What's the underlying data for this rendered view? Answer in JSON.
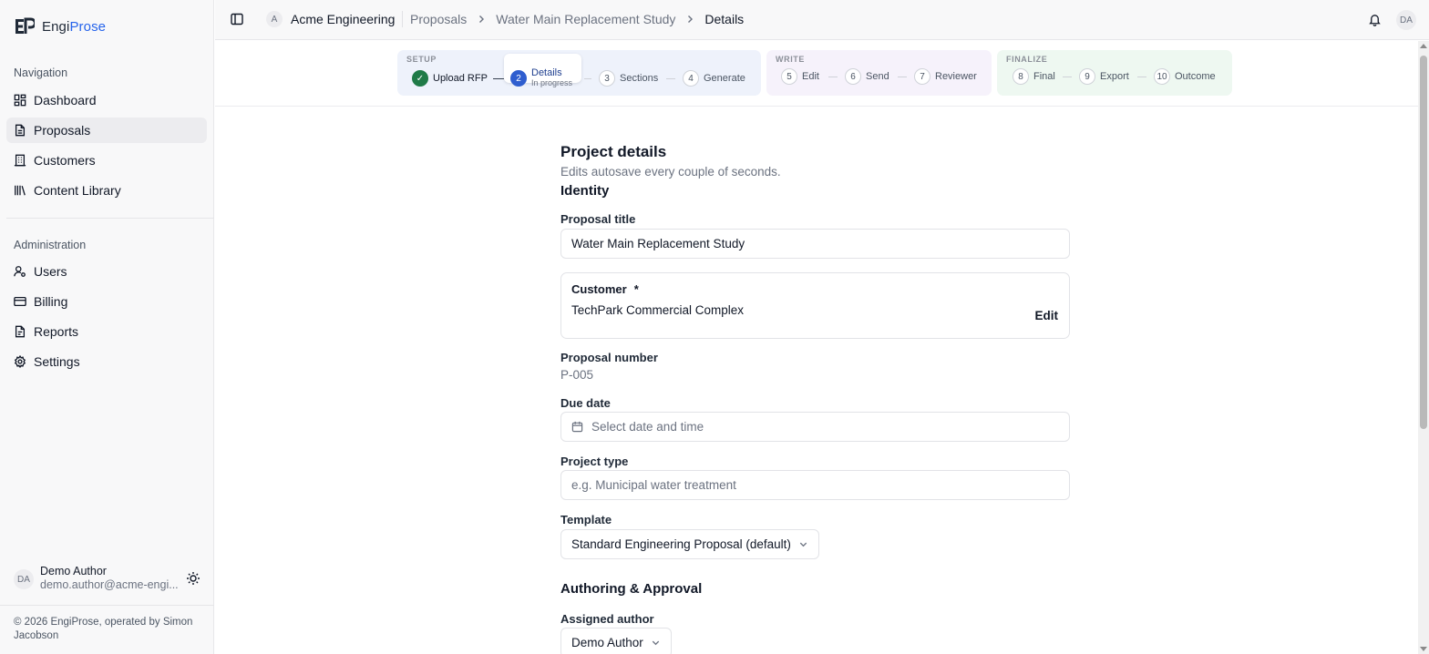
{
  "brand": {
    "name_prefix": "Engi",
    "name_suffix": "Prose"
  },
  "sidebar": {
    "navigation_label": "Navigation",
    "navigation": [
      {
        "label": "Dashboard",
        "icon": "dashboard-icon",
        "active": false
      },
      {
        "label": "Proposals",
        "icon": "document-icon",
        "active": true
      },
      {
        "label": "Customers",
        "icon": "building-icon",
        "active": false
      },
      {
        "label": "Content Library",
        "icon": "library-icon",
        "active": false
      }
    ],
    "administration_label": "Administration",
    "administration": [
      {
        "label": "Users",
        "icon": "user-cog-icon"
      },
      {
        "label": "Billing",
        "icon": "credit-card-icon"
      },
      {
        "label": "Reports",
        "icon": "report-icon"
      },
      {
        "label": "Settings",
        "icon": "gear-icon"
      }
    ],
    "user": {
      "initials": "DA",
      "name": "Demo Author",
      "email": "demo.author@acme-engi..."
    },
    "footer": "© 2026 EngiProse, operated by Simon Jacobson"
  },
  "topbar": {
    "org_initial": "A",
    "org_name": "Acme Engineering",
    "breadcrumbs": [
      "Proposals",
      "Water Main Replacement Study",
      "Details"
    ],
    "user_initials": "DA"
  },
  "stepper": {
    "phases": [
      {
        "label": "SETUP"
      },
      {
        "label": "WRITE"
      },
      {
        "label": "FINALIZE"
      }
    ],
    "steps": [
      {
        "num": "✓",
        "label": "Upload RFP",
        "state": "done"
      },
      {
        "num": "2",
        "label": "Details",
        "sublabel": "In progress",
        "state": "active"
      },
      {
        "num": "3",
        "label": "Sections",
        "state": "todo"
      },
      {
        "num": "4",
        "label": "Generate",
        "state": "todo"
      },
      {
        "num": "5",
        "label": "Edit",
        "state": "todo"
      },
      {
        "num": "6",
        "label": "Send",
        "state": "todo"
      },
      {
        "num": "7",
        "label": "Reviewer",
        "state": "todo"
      },
      {
        "num": "8",
        "label": "Final",
        "state": "todo"
      },
      {
        "num": "9",
        "label": "Export",
        "state": "todo"
      },
      {
        "num": "10",
        "label": "Outcome",
        "state": "todo"
      }
    ]
  },
  "form": {
    "title": "Project details",
    "subtitle": "Edits autosave every couple of seconds.",
    "identity_heading": "Identity",
    "proposal_title_label": "Proposal title",
    "proposal_title_value": "Water Main Replacement Study",
    "customer_label": "Customer",
    "customer_required": "*",
    "customer_value": "TechPark Commercial Complex",
    "customer_edit": "Edit",
    "proposal_number_label": "Proposal number",
    "proposal_number_value": "P-005",
    "due_date_label": "Due date",
    "due_date_placeholder": "Select date and time",
    "project_type_label": "Project type",
    "project_type_placeholder": "e.g. Municipal water treatment",
    "template_label": "Template",
    "template_value": "Standard Engineering Proposal (default)",
    "authoring_heading": "Authoring & Approval",
    "assigned_author_label": "Assigned author",
    "assigned_author_value": "Demo Author"
  }
}
